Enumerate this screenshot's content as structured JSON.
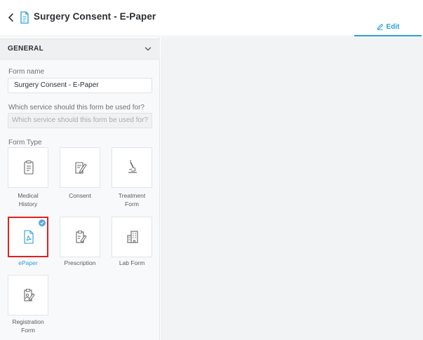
{
  "header": {
    "title": "Surgery Consent - E-Paper",
    "edit_label": "Edit"
  },
  "sidebar": {
    "section_title": "GENERAL",
    "form_name": {
      "label": "Form name",
      "value": "Surgery Consent - E-Paper"
    },
    "service": {
      "label": "Which service should this form be used for?",
      "placeholder": "Which service should this form be used for?"
    },
    "form_type_label": "Form Type",
    "form_types": [
      {
        "label": "Medical History",
        "line1": "Medical",
        "line2": "History",
        "icon": "clipboard-icon",
        "selected": false
      },
      {
        "label": "Consent",
        "line1": "Consent",
        "line2": "",
        "icon": "sign-document-icon",
        "selected": false
      },
      {
        "label": "Treatment Form",
        "line1": "Treatment",
        "line2": "Form",
        "icon": "microscope-icon",
        "selected": false
      },
      {
        "label": "ePaper",
        "line1": "ePaper",
        "line2": "",
        "icon": "pdf-document-icon",
        "selected": true
      },
      {
        "label": "Prescription",
        "line1": "Prescription",
        "line2": "",
        "icon": "prescription-icon",
        "selected": false
      },
      {
        "label": "Lab Form",
        "line1": "Lab Form",
        "line2": "",
        "icon": "lab-building-icon",
        "selected": false
      },
      {
        "label": "Registration Form",
        "line1": "Registration",
        "line2": "Form",
        "icon": "registration-clipboard-icon",
        "selected": false
      }
    ]
  },
  "colors": {
    "accent": "#2a9fd6",
    "selected_border": "#e02020",
    "check_badge": "#5aa7e0"
  }
}
